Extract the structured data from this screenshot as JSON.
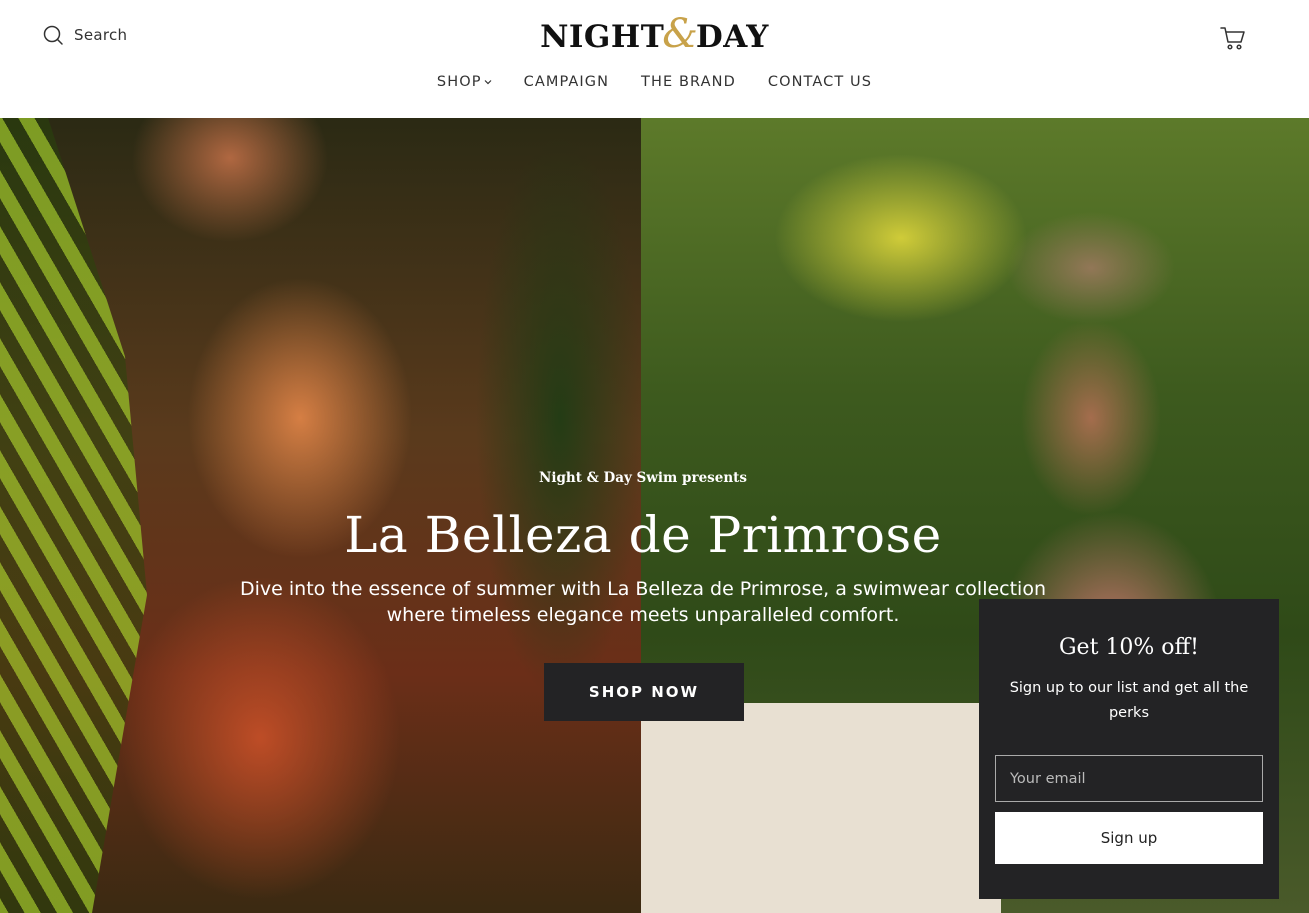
{
  "header": {
    "search_label": "Search",
    "logo": {
      "left": "NIGHT",
      "amp": "&",
      "right": "DAY"
    },
    "nav": [
      {
        "label": "SHOP",
        "has_dropdown": true
      },
      {
        "label": "CAMPAIGN"
      },
      {
        "label": "THE BRAND"
      },
      {
        "label": "CONTACT US"
      }
    ],
    "icons": {
      "search": "search-icon",
      "cart": "cart-icon",
      "dropdown": "chevron-down-icon"
    }
  },
  "hero": {
    "eyebrow": "Night & Day Swim presents",
    "title": "La Belleza de Primrose",
    "subtitle_line1": "Dive into the essence of summer with La Belleza de Primrose, a swimwear collection",
    "subtitle_line2": "where timeless elegance meets unparalleled comfort.",
    "cta": "SHOP NOW"
  },
  "popup": {
    "title": "Get 10% off!",
    "text": "Sign up to our list and get all the perks",
    "email_placeholder": "Your email",
    "button": "Sign up"
  },
  "colors": {
    "accent_gold": "#c8a24a",
    "dark": "#232325",
    "white": "#ffffff"
  }
}
